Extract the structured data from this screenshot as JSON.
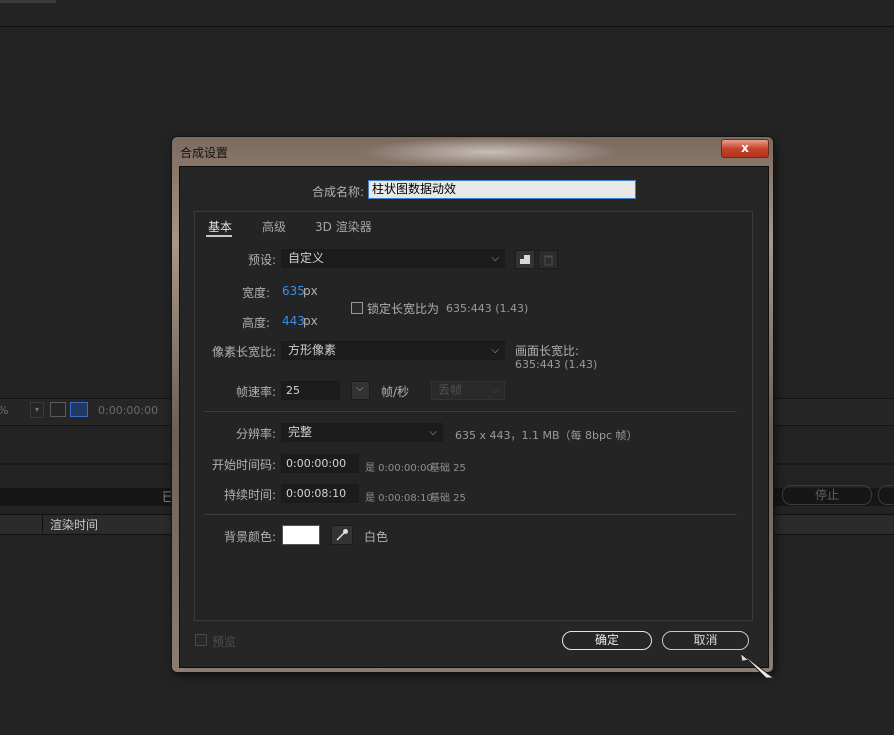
{
  "background": {
    "zoom_pct": "%",
    "timecode": "0:00:00:00",
    "bar_text": "已",
    "stop_label": "停止",
    "column_render_time": "渲染时间"
  },
  "dialog": {
    "title": "合成设置",
    "close_glyph": "x",
    "name_label": "合成名称:",
    "name_value": "柱状图数据动效",
    "tabs": [
      "基本",
      "高级",
      "3D 渲染器"
    ],
    "preset": {
      "label": "预设:",
      "value": "自定义"
    },
    "width": {
      "label": "宽度:",
      "value": "635",
      "unit": "px"
    },
    "height": {
      "label": "高度:",
      "value": "443",
      "unit": "px"
    },
    "lock_aspect": {
      "label": "锁定长宽比为",
      "ratio": "635:443 (1.43)",
      "checked": false
    },
    "pixel_aspect": {
      "label": "像素长宽比:",
      "value": "方形像素"
    },
    "frame_aspect": {
      "label": "画面长宽比:",
      "value": "635:443 (1.43)"
    },
    "frame_rate": {
      "label": "帧速率:",
      "value": "25",
      "unit": "帧/秒",
      "drop_frame": "丢帧"
    },
    "resolution": {
      "label": "分辨率:",
      "value": "完整",
      "info": "635 x 443，1.1 MB（每 8bpc 帧）"
    },
    "start_timecode": {
      "label": "开始时间码:",
      "value": "0:00:00:00",
      "is_label": "是 0:00:00:00",
      "base_label": "基础 25"
    },
    "duration": {
      "label": "持续时间:",
      "value": "0:00:08:10",
      "is_label": "是 0:00:08:10",
      "base_label": "基础 25"
    },
    "background_color": {
      "label": "背景颜色:",
      "hex": "#ffffff",
      "name": "白色"
    },
    "preview_label": "预览",
    "ok_label": "确定",
    "cancel_label": "取消"
  }
}
